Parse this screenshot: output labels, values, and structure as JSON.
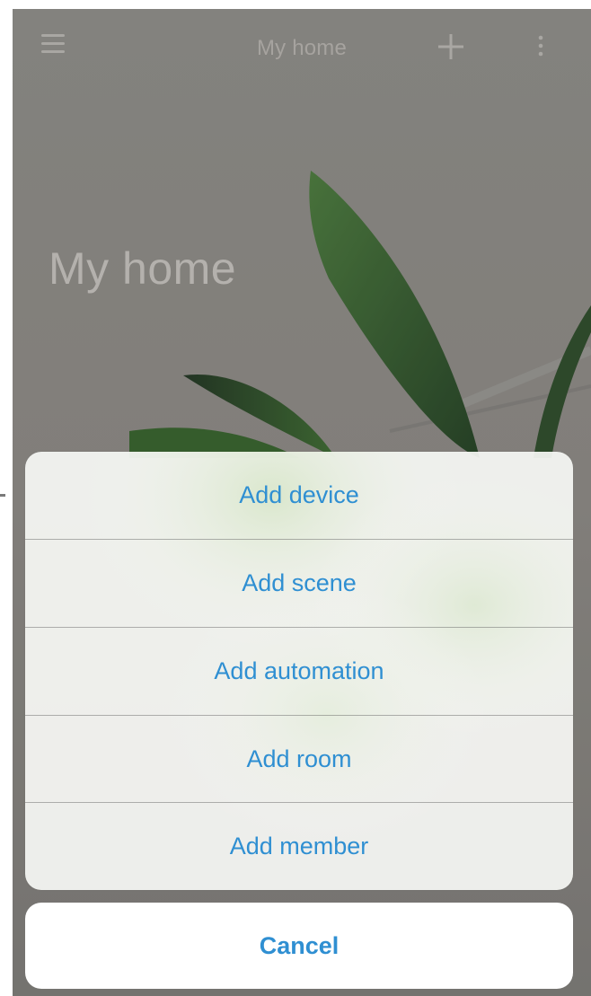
{
  "header": {
    "title": "My home",
    "menu_icon": "hamburger-menu-icon",
    "add_icon": "plus-icon",
    "more_icon": "vertical-ellipsis-icon"
  },
  "page": {
    "heading": "My home"
  },
  "action_sheet": {
    "items": [
      {
        "label": "Add device"
      },
      {
        "label": "Add scene"
      },
      {
        "label": "Add automation"
      },
      {
        "label": "Add room"
      },
      {
        "label": "Add member"
      }
    ],
    "cancel_label": "Cancel"
  },
  "colors": {
    "action_text": "#2f8fd2",
    "background_overlay": "#8b8985",
    "header_icons": "#a9a7a3"
  }
}
